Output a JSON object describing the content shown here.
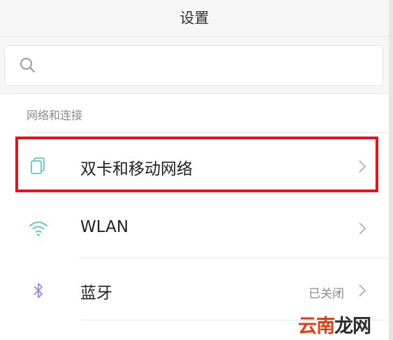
{
  "header": {
    "title": "设置"
  },
  "search": {
    "placeholder": "",
    "value": ""
  },
  "section": {
    "title": "网络和连接"
  },
  "rows": [
    {
      "label": "双卡和移动网络",
      "status": "",
      "icon": "sim-cards-icon",
      "highlighted": true
    },
    {
      "label": "WLAN",
      "status": "",
      "icon": "wifi-icon"
    },
    {
      "label": "蓝牙",
      "status": "已关闭",
      "icon": "bluetooth-icon"
    }
  ],
  "watermark": {
    "part1": "云南",
    "part2": "龙网"
  },
  "colors": {
    "accent": "#5cc8c6",
    "bluetooth": "#9a86e8",
    "highlight": "#e1151f",
    "header_bg": "#f6f6f6"
  }
}
